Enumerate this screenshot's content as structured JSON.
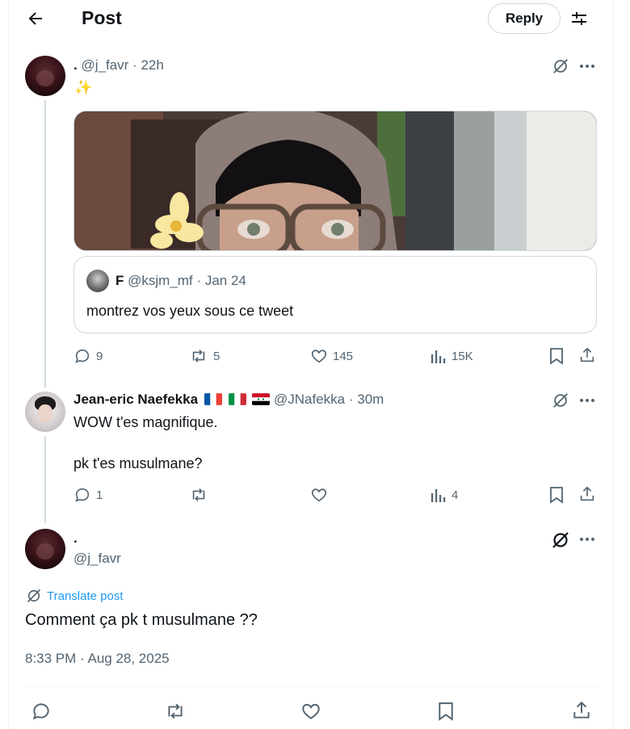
{
  "header": {
    "title": "Post",
    "reply_label": "Reply",
    "back_icon": "arrow-left-icon",
    "filter_icon": "sliders-icon"
  },
  "tweet1": {
    "name": ".",
    "handle": "@j_favr",
    "separator": "·",
    "time": "22h",
    "text": "✨",
    "quote": {
      "name": "F",
      "handle": "@ksjm_mf",
      "separator": "·",
      "date": "Jan 24",
      "text": "montrez vos yeux sous ce tweet"
    },
    "actions": {
      "replies": "9",
      "reposts": "5",
      "likes": "145",
      "views": "15K"
    }
  },
  "tweet2": {
    "name": "Jean-eric Naefekka",
    "handle": "@JNafekka",
    "separator": "·",
    "time": "30m",
    "line1": "WOW t'es magnifique.",
    "line2": "pk t'es musulmane?",
    "actions": {
      "replies": "1",
      "views": "4"
    }
  },
  "main": {
    "name": ".",
    "handle": "@j_favr",
    "translate_label": "Translate post",
    "text": "Comment ça pk t musulmane ??",
    "timestamp": "8:33 PM · Aug 28, 2025"
  },
  "colors": {
    "accent": "#1d9bf0",
    "muted": "#536471",
    "border": "#cfd9de"
  }
}
